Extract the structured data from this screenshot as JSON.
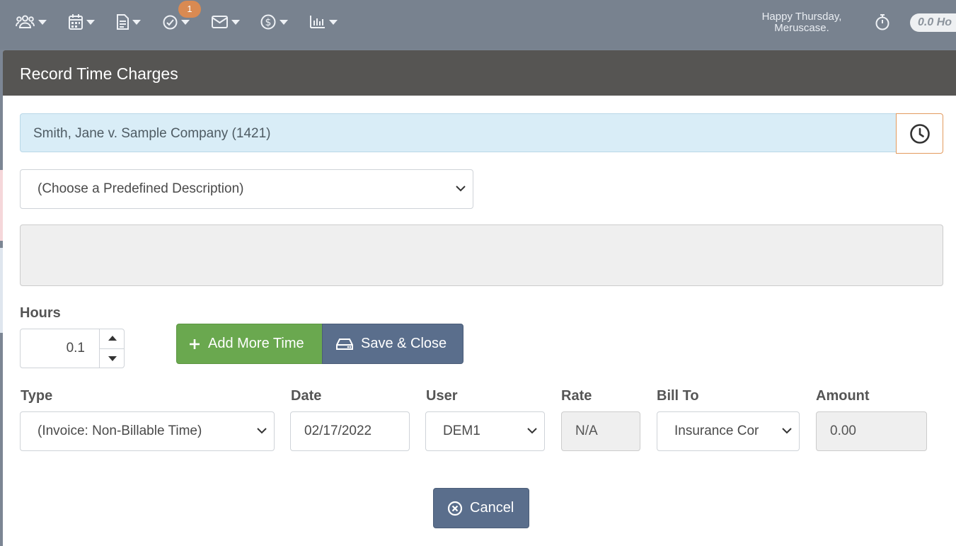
{
  "nav": {
    "items": [
      {
        "icon": "users-icon"
      },
      {
        "icon": "calendar-icon"
      },
      {
        "icon": "document-icon"
      },
      {
        "icon": "task-check-icon",
        "badge": "1"
      },
      {
        "icon": "mail-icon"
      },
      {
        "icon": "dollar-icon"
      },
      {
        "icon": "bar-chart-icon"
      }
    ],
    "greeting_line1": "Happy Thursday,",
    "greeting_line2": "Meruscase.",
    "timer_icon": "stopwatch-icon",
    "hours_pill": "0.0 Ho"
  },
  "modal": {
    "title": "Record Time Charges",
    "case": "Smith, Jane v. Sample Company (1421)",
    "description_select": "(Choose a Predefined Description)",
    "description_text": "",
    "hours_label": "Hours",
    "hours_value": "0.1",
    "add_more_time": "Add More Time",
    "save_close": "Save & Close",
    "cancel": "Cancel",
    "fields": {
      "type_label": "Type",
      "type_value": "(Invoice: Non-Billable Time)",
      "date_label": "Date",
      "date_value": "02/17/2022",
      "user_label": "User",
      "user_value": "DEM1",
      "rate_label": "Rate",
      "rate_value": "N/A",
      "billto_label": "Bill To",
      "billto_value": "Insurance Cor",
      "amount_label": "Amount",
      "amount_value": "0.00"
    }
  },
  "colors": {
    "header": "#565553",
    "success": "#6aa84f",
    "primary": "#5a6e8c",
    "badge": "#d98a52",
    "info_bg": "#d9edf7"
  }
}
